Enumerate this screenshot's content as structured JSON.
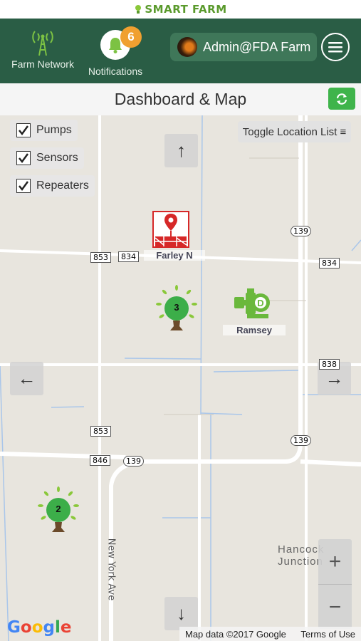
{
  "brand": {
    "name": "SMART FARM"
  },
  "header": {
    "farm_network_label": "Farm Network",
    "notifications_label": "Notifications",
    "notifications_count": "6",
    "user_label": "Admin@FDA Farm"
  },
  "page": {
    "title": "Dashboard & Map"
  },
  "filters": [
    {
      "label": "Pumps",
      "checked": true
    },
    {
      "label": "Sensors",
      "checked": true
    },
    {
      "label": "Repeaters",
      "checked": true
    }
  ],
  "toggle_location_list": "Toggle Location List ≡",
  "map": {
    "road_labels": [
      "853",
      "834",
      "139",
      "834",
      "838",
      "853",
      "846",
      "139",
      "139"
    ],
    "markers": [
      {
        "label": "Farley N",
        "kind": "repeater"
      },
      {
        "label": "Ramsey",
        "kind": "pump"
      }
    ],
    "clusters": [
      "3",
      "2"
    ],
    "street_label": "New York Ave",
    "place_label_line1": "Hancock",
    "place_label_line2": "Junction",
    "zoom_in": "+",
    "zoom_out": "−",
    "attribution": "Map data ©2017 Google",
    "terms": "Terms of Use",
    "google_logo": "Google"
  },
  "nav_arrows": {
    "up": "↑",
    "down": "↓",
    "left": "←",
    "right": "→"
  },
  "colors": {
    "header_bg": "#2a5d45",
    "accent_green": "#3fb44b",
    "badge": "#f0a030",
    "alert_red": "#d62828"
  }
}
